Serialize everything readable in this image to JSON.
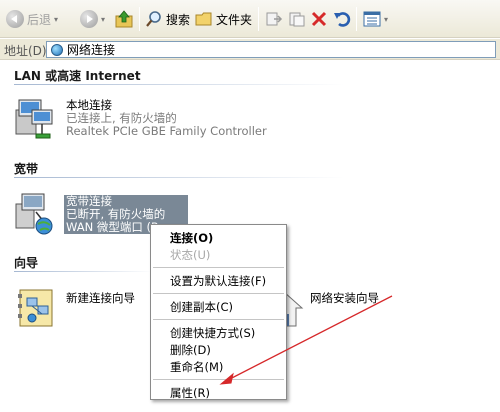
{
  "toolbar": {
    "back_label": "后退",
    "search_label": "搜索",
    "folders_label": "文件夹"
  },
  "address": {
    "label": "地址(D)",
    "value": "网络连接"
  },
  "groups": {
    "lan": "LAN 或高速 Internet",
    "broadband": "宽带",
    "wizard": "向导"
  },
  "local_conn": {
    "name": "本地连接",
    "status": "已连接上, 有防火墙的",
    "device": "Realtek PCIe GBE Family Controller"
  },
  "broadband_conn": {
    "name": "宽带连接",
    "status": "已断开, 有防火墙的",
    "device": "WAN 微型端口 (P"
  },
  "wizards": {
    "new_conn": "新建连接向导",
    "home_net": "网络安装向导"
  },
  "context_menu": {
    "connect": "连接(O)",
    "status": "状态(U)",
    "set_default": "设置为默认连接(F)",
    "copy": "创建副本(C)",
    "shortcut": "创建快捷方式(S)",
    "delete": "删除(D)",
    "rename": "重命名(M)",
    "properties": "属性(R)"
  },
  "colors": {
    "arrow": "#d6282a",
    "selection": "#7a8896"
  }
}
